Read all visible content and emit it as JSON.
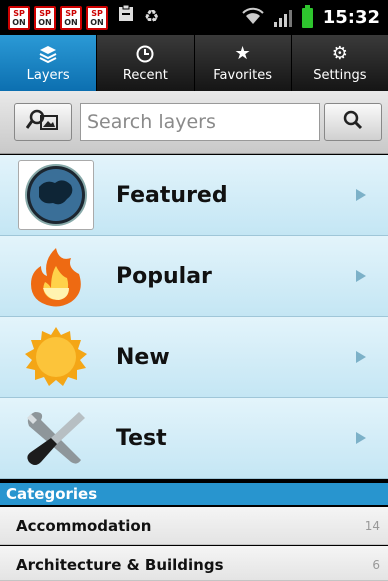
{
  "status_bar": {
    "sp_icons": [
      {
        "top": "SP",
        "bottom": "ON"
      },
      {
        "top": "SP",
        "bottom": "ON"
      },
      {
        "top": "SP",
        "bottom": "ON"
      },
      {
        "top": "SP",
        "bottom": "ON"
      }
    ],
    "extra_icons": [
      "clipboard-icon",
      "recycle-icon"
    ],
    "right_icons": [
      "wifi-icon",
      "signal-icon",
      "battery-icon"
    ],
    "time": "15:32"
  },
  "tabs": [
    {
      "label": "Layers",
      "icon": "layers-icon",
      "active": true
    },
    {
      "label": "Recent",
      "icon": "clock-icon",
      "active": false
    },
    {
      "label": "Favorites",
      "icon": "star-icon",
      "active": false
    },
    {
      "label": "Settings",
      "icon": "gear-icon",
      "active": false
    }
  ],
  "search": {
    "placeholder": "Search layers",
    "value": "",
    "left_button_icon": "image-search-icon",
    "right_button_icon": "magnifier-icon"
  },
  "layers": [
    {
      "title": "Featured",
      "icon": "globe-europe-icon"
    },
    {
      "title": "Popular",
      "icon": "flame-icon"
    },
    {
      "title": "New",
      "icon": "sun-badge-icon"
    },
    {
      "title": "Test",
      "icon": "tools-icon"
    }
  ],
  "categories": {
    "header": "Categories",
    "items": [
      {
        "label": "Accommodation",
        "count": "14"
      },
      {
        "label": "Architecture & Buildings",
        "count": "6"
      }
    ]
  },
  "colors": {
    "accent_blue": "#1a86c8",
    "list_bg": "#d3edf8",
    "category_header": "#2895cf",
    "battery_green": "#2ec52e"
  }
}
